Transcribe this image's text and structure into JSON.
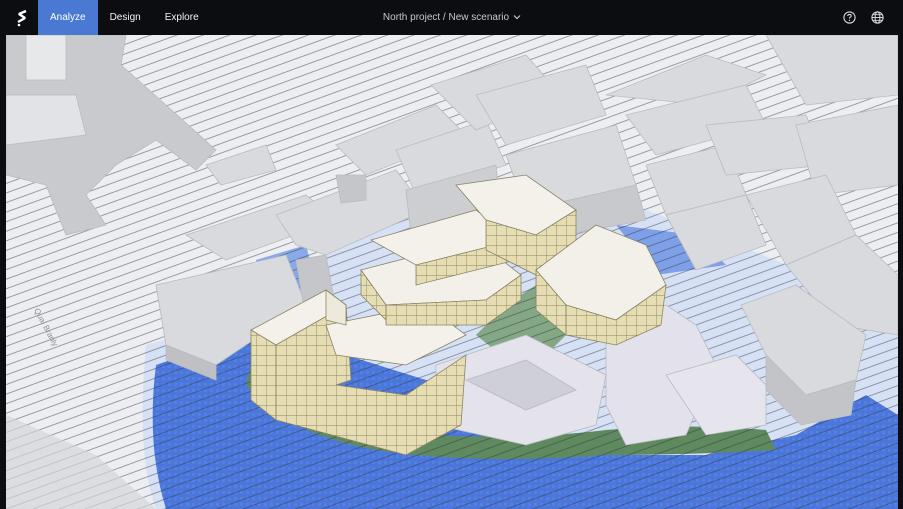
{
  "app": {
    "logo_icon": "spacemaker-logo-icon",
    "accent_color": "#4a79d4"
  },
  "tabs": [
    {
      "label": "Analyze",
      "active": true
    },
    {
      "label": "Design",
      "active": false
    },
    {
      "label": "Explore",
      "active": false
    }
  ],
  "project": {
    "title": "North project / New scenario",
    "dropdown_icon": "chevron-down-icon"
  },
  "toolbar_right": {
    "help_icon": "help-icon",
    "language_icon": "globe-icon"
  },
  "map": {
    "street_label": "Quai Branly",
    "legend_colors": {
      "buildings_proposed": "#e5dcb0",
      "buildings_context": "#d9dadd",
      "wind_high": "#3f6fd8",
      "vegetation": "#5e8a5e"
    }
  }
}
